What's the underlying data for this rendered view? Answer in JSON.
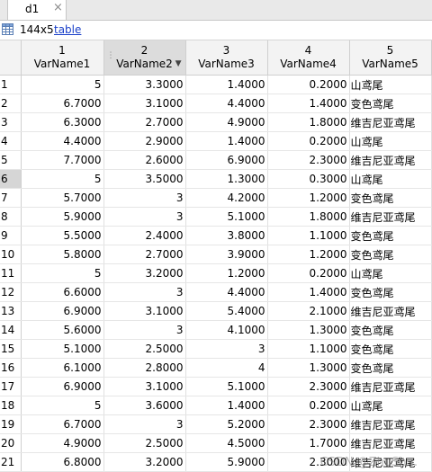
{
  "tab": {
    "title": "d1",
    "close_glyph": "×"
  },
  "info": {
    "icon": "table-grid-icon",
    "size": "144x5",
    "type_link": "table"
  },
  "columns": [
    {
      "index": "1",
      "name": "VarName1"
    },
    {
      "index": "2",
      "name": "VarName2"
    },
    {
      "index": "3",
      "name": "VarName3"
    },
    {
      "index": "4",
      "name": "VarName4"
    },
    {
      "index": "5",
      "name": "VarName5"
    }
  ],
  "rows": [
    [
      "1",
      "5",
      "3.3000",
      "1.4000",
      "0.2000",
      "山鸢尾"
    ],
    [
      "2",
      "6.7000",
      "3.1000",
      "4.4000",
      "1.4000",
      "变色鸢尾"
    ],
    [
      "3",
      "6.3000",
      "2.7000",
      "4.9000",
      "1.8000",
      "维吉尼亚鸢尾"
    ],
    [
      "4",
      "4.4000",
      "2.9000",
      "1.4000",
      "0.2000",
      "山鸢尾"
    ],
    [
      "5",
      "7.7000",
      "2.6000",
      "6.9000",
      "2.3000",
      "维吉尼亚鸢尾"
    ],
    [
      "6",
      "5",
      "3.5000",
      "1.3000",
      "0.3000",
      "山鸢尾"
    ],
    [
      "7",
      "5.7000",
      "3",
      "4.2000",
      "1.2000",
      "变色鸢尾"
    ],
    [
      "8",
      "5.9000",
      "3",
      "5.1000",
      "1.8000",
      "维吉尼亚鸢尾"
    ],
    [
      "9",
      "5.5000",
      "2.4000",
      "3.8000",
      "1.1000",
      "变色鸢尾"
    ],
    [
      "10",
      "5.8000",
      "2.7000",
      "3.9000",
      "1.2000",
      "变色鸢尾"
    ],
    [
      "11",
      "5",
      "3.2000",
      "1.2000",
      "0.2000",
      "山鸢尾"
    ],
    [
      "12",
      "6.6000",
      "3",
      "4.4000",
      "1.4000",
      "变色鸢尾"
    ],
    [
      "13",
      "6.9000",
      "3.1000",
      "5.4000",
      "2.1000",
      "维吉尼亚鸢尾"
    ],
    [
      "14",
      "5.6000",
      "3",
      "4.1000",
      "1.3000",
      "变色鸢尾"
    ],
    [
      "15",
      "5.1000",
      "2.5000",
      "3",
      "1.1000",
      "变色鸢尾"
    ],
    [
      "16",
      "6.1000",
      "2.8000",
      "4",
      "1.3000",
      "变色鸢尾"
    ],
    [
      "17",
      "6.9000",
      "3.1000",
      "5.1000",
      "2.3000",
      "维吉尼亚鸢尾"
    ],
    [
      "18",
      "5",
      "3.6000",
      "1.4000",
      "0.2000",
      "山鸢尾"
    ],
    [
      "19",
      "6.7000",
      "3",
      "5.2000",
      "2.3000",
      "维吉尼亚鸢尾"
    ],
    [
      "20",
      "4.9000",
      "2.5000",
      "4.5000",
      "1.7000",
      "维吉尼亚鸢尾"
    ],
    [
      "21",
      "6.8000",
      "3.2000",
      "5.9000",
      "2.3000",
      "维吉尼亚鸢尾"
    ]
  ],
  "selected_row": "6",
  "selected_column": "2",
  "watermark": "CSDN @ZhuSh..."
}
